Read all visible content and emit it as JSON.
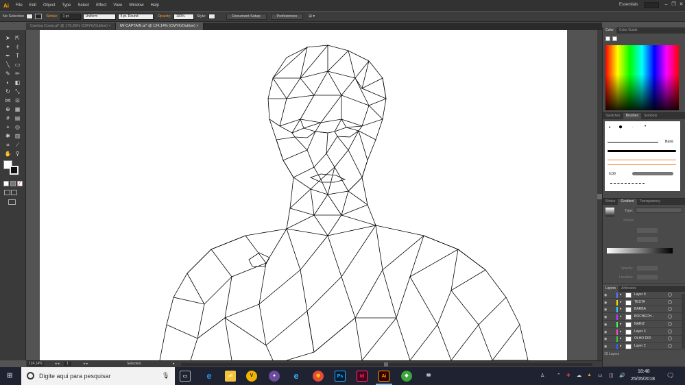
{
  "app": {
    "logo": "Ai",
    "menus": [
      "File",
      "Edit",
      "Object",
      "Type",
      "Select",
      "Effect",
      "View",
      "Window",
      "Help"
    ],
    "workspace": "Essentials",
    "window_controls": [
      "–",
      "❐",
      "✕"
    ]
  },
  "controlbar": {
    "selection_label": "No Selection",
    "stroke_label": "Stroke:",
    "stroke_weight": "1 pt",
    "profile": "Uniform",
    "brush": "5 pt. Round",
    "opacity_label": "Opacity:",
    "opacity_value": "100%",
    "style_label": "Style:",
    "document_setup": "Document Setup",
    "preferences": "Preferences"
  },
  "tabs": [
    {
      "label": "Camisa Costa.ai* @ 179,65% (CMYK/Outline)",
      "close": "×"
    },
    {
      "label": "IW-CAPTAIN.ai* @ 124,14% (CMYK/Outline)",
      "close": "×"
    }
  ],
  "status": {
    "zoom": "124,14%",
    "artboard_num": "1",
    "tool_name": "Selection"
  },
  "color_panel": {
    "tabs": [
      "Color",
      "Color Guide"
    ]
  },
  "brushes_panel": {
    "tabs": [
      "Swatches",
      "Brushes",
      "Symbols"
    ],
    "basic_label": "Basic",
    "size_value": "6,00"
  },
  "gradient_panel": {
    "tabs": [
      "Stroke",
      "Gradient",
      "Transparency"
    ],
    "type_label": "Type:",
    "stroke_label": "Stroke:",
    "opacity_label": "Opacity:",
    "location_label": "Location:"
  },
  "layers_panel": {
    "tabs": [
      "Layers",
      "Artboards"
    ],
    "count": "16 Layers",
    "layers": [
      {
        "name": "Layer 9",
        "color": "#4f7cff"
      },
      {
        "name": "TESTA",
        "color": "#ffdd00"
      },
      {
        "name": "BARBA",
        "color": "#2dd1ff"
      },
      {
        "name": "BOCHECH...",
        "color": "#b03cff"
      },
      {
        "name": "NARIZ",
        "color": "#3cff5a"
      },
      {
        "name": "Layer 3",
        "color": "#ff4cc4"
      },
      {
        "name": "OLHO DIR",
        "color": "#2bd24a"
      },
      {
        "name": "Layer 2",
        "color": "#2d62ff"
      }
    ]
  },
  "taskbar": {
    "search_placeholder": "Digite aqui para pesquisar",
    "time": "18:48",
    "date": "25/05/2018",
    "apps": [
      "e",
      "📁",
      "V",
      "●",
      "e",
      "◉",
      "Ps",
      "Id",
      "Ai",
      "◆",
      "✉"
    ]
  }
}
